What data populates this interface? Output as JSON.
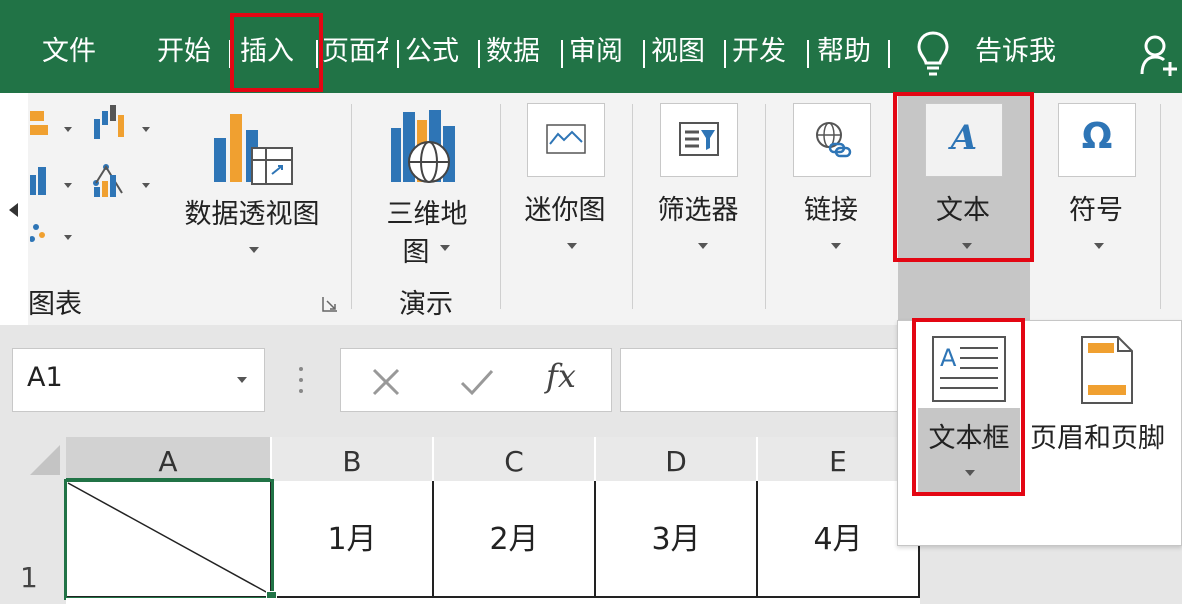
{
  "tabs": [
    "文件",
    "开始",
    "插入",
    "页面布",
    "公式",
    "数据",
    "审阅",
    "视图",
    "开发",
    "帮助",
    "告诉我"
  ],
  "ribbon": {
    "pivot_chart": "数据透视图",
    "map3d_line1": "三维地",
    "map3d_line2": "图",
    "sparkline": "迷你图",
    "filter": "筛选器",
    "link": "链接",
    "text": "文本",
    "symbol": "符号",
    "group_charts": "图表",
    "group_tours": "演示"
  },
  "formula_bar": {
    "name_box": "A1",
    "fx": "fx",
    "formula_value": ""
  },
  "grid": {
    "columns": [
      "A",
      "B",
      "C",
      "D",
      "E"
    ],
    "row_label": "1",
    "cells": [
      "",
      "1月",
      "2月",
      "3月",
      "4月"
    ]
  },
  "dropdown": {
    "textbox": "文本框",
    "header_footer": "页眉和页脚"
  },
  "colors": {
    "ribbon_green": "#217346",
    "highlight_red": "#e30613",
    "selected_gray": "#c6c6c6"
  }
}
